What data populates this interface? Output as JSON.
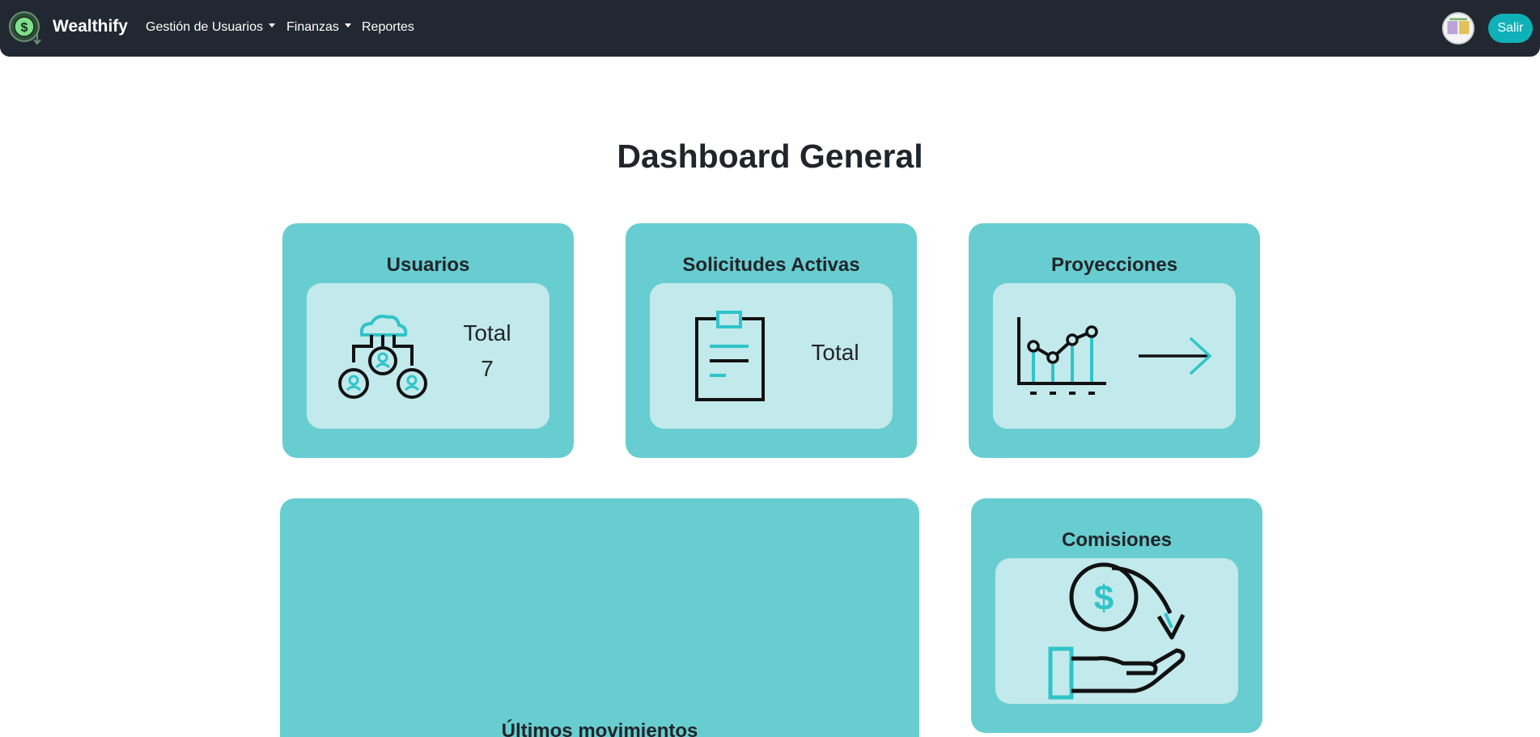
{
  "navbar": {
    "brand": "Wealthify",
    "menu": [
      {
        "label": "Gestión de Usuarios",
        "dropdown": true
      },
      {
        "label": "Finanzas",
        "dropdown": true
      },
      {
        "label": "Reportes",
        "dropdown": false
      }
    ],
    "logout_label": "Salir"
  },
  "page": {
    "title": "Dashboard General"
  },
  "cards": {
    "usuarios": {
      "title": "Usuarios",
      "total_label": "Total",
      "total_value": "7"
    },
    "solicitudes": {
      "title": "Solicitudes Activas",
      "total_label": "Total"
    },
    "proyecciones": {
      "title": "Proyecciones"
    },
    "movimientos": {
      "title": "Últimos movimientos"
    },
    "comisiones": {
      "title": "Comisiones"
    }
  },
  "colors": {
    "navbar_bg": "#222831",
    "card_bg": "#68cdd0",
    "card_inner_bg": "#c2e9eb",
    "accent": "#0fb1b8",
    "icon_accent": "#2fc4c9"
  },
  "icons": [
    "dollar-coin-logo-icon",
    "network-users-icon",
    "clipboard-icon",
    "line-chart-icon",
    "arrow-right-icon",
    "hand-coin-icon"
  ]
}
